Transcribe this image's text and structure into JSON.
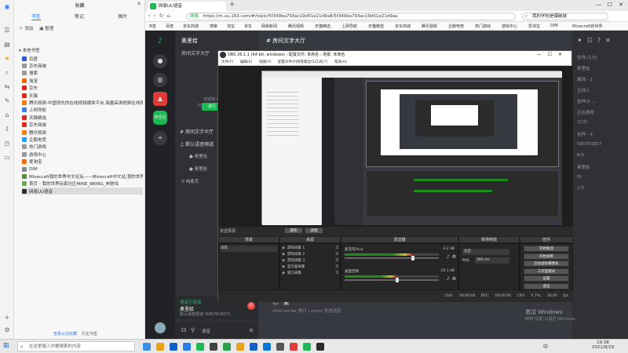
{
  "browser": {
    "tab_title": "网易UU语音",
    "tab_icon_text": "网易",
    "url": "https://m.uu.163.com/#/topic/5f349ba793ac19d51e21d9a8/5f349ba793ac19d51e21d9aa",
    "side_search": "我的学校是爆破城",
    "bookmarks": [
      "书签",
      "百度",
      "京东商城",
      "搜索",
      "淘宝",
      "京东",
      "网易新闻",
      "腾讯视频",
      "天猫精选",
      "上网导航",
      "天猫精选",
      "京东商城",
      "腾讯视频",
      "企鹅电竞",
      "热门游戏",
      "游戏中心",
      "爱淘宝",
      "DIM",
      "Minecraft的世界"
    ],
    "window_controls": [
      "—",
      "☐",
      "✕"
    ]
  },
  "favorites": {
    "header_title": "收藏",
    "tabs": [
      "书签",
      "笔记",
      "图片"
    ],
    "toolbar": [
      "添加",
      "整理"
    ],
    "root": "本地书签",
    "items": [
      {
        "label": "百度",
        "color": "#2b5bd7"
      },
      {
        "label": "京东商城",
        "color": "#999999"
      },
      {
        "label": "搜索",
        "color": "#999999"
      },
      {
        "label": "淘宝",
        "color": "#ff6a00"
      },
      {
        "label": "京东",
        "color": "#e1251b"
      },
      {
        "label": "天猫",
        "color": "#e1251b"
      },
      {
        "label": "腾讯视频-中国领先的在线视频媒体平台,海量高清视频在线观看",
        "color": "#ff7a00"
      },
      {
        "label": "上网导航",
        "color": "#3d7ae8"
      },
      {
        "label": "天猫精选",
        "color": "#e1251b"
      },
      {
        "label": "京东商城",
        "color": "#e1251b"
      },
      {
        "label": "腾讯视频",
        "color": "#ff7a00"
      },
      {
        "label": "企鹅电竞",
        "color": "#18a3ff"
      },
      {
        "label": "热门游戏",
        "color": "#999999"
      },
      {
        "label": "游戏中心",
        "color": "#999999"
      },
      {
        "label": "爱淘宝",
        "color": "#ff6a00"
      },
      {
        "label": "DIM",
        "color": "#888888"
      },
      {
        "label": "Minecraft我的世界中文论坛——Minecraft中文站,我的世界中文",
        "color": "#5a8d3a"
      },
      {
        "label": "首页 - 我的世界玩家社区MINE_BBING_奔驰咕",
        "color": "#6aa84f"
      },
      {
        "label": "网易UU语音",
        "color": "#2b2d31"
      }
    ],
    "footer": [
      "查看以往收藏",
      "历史书签"
    ]
  },
  "discord": {
    "server_label": "奥里给",
    "channel_header": "房间文字大厅",
    "channel_title": "# 房间文字大厅",
    "text_channel": "房间文字大厅",
    "voice_channel": "默认语音频道",
    "voice_users": [
      "奥里给",
      "奥里给"
    ],
    "mic_label": "纯麦克",
    "welcome_text": "欢迎加入服务器",
    "enter_channel_hint": "只需要聊一下 就可以进",
    "join_button": "进行",
    "user_name": "奥里给",
    "user_status": "默认语音频道 (585761827)",
    "status_sub": "语音已连接",
    "tab_label": "语音",
    "message_placeholder": "shift+enter 换行 / enter 发送消息",
    "members_header": "在线 - 1/3",
    "members": [
      "在线 (1/3)",
      "奥里给",
      "离线 - 2",
      "主持人",
      "吉祥(5 ...",
      "正在游戏",
      "(1/3)",
      "吉祥 - 4",
      "585761827",
      "6/3",
      "奥里给",
      "ID",
      "1/3"
    ],
    "top_icons": [
      "pin-icon",
      "members-icon",
      "help-icon",
      "close-icon"
    ]
  },
  "obs": {
    "title": "OBS 26.1.1 (64-bit, windows) - 配置文件: 未命名 - 场景: 未命名",
    "menu": [
      "文件(F)",
      "编辑(E)",
      "视图(V)",
      "配置文件(P)",
      "场景集合(S)",
      "工具(T)",
      "帮助(H)"
    ],
    "panels": {
      "scenes": "场景",
      "sources": "来源",
      "mixer": "混音器",
      "transitions": "转场特效",
      "controls": "控件"
    },
    "no_source_label": "未选择源",
    "properties_button": "属性",
    "filters_button": "滤镜",
    "scene_item": "场景",
    "sources": [
      "游戏采集 1",
      "游戏采集 2",
      "游戏采集 3",
      "显示器采集",
      "窗口采集"
    ],
    "mixer_tracks": [
      {
        "name": "麦克风/Aux",
        "db": "-3.2 dB",
        "level": 0.72
      },
      {
        "name": "桌面音频",
        "db": "-10.1 dB",
        "level": 0.55
      }
    ],
    "transition": {
      "type": "淡出",
      "duration_label": "时长",
      "duration": "300 ms"
    },
    "controls": [
      "开始推流",
      "开始录制",
      "启动虚拟摄像机",
      "工作室模式",
      "设置",
      "退出"
    ],
    "status": {
      "live": "LIVE: 00:00:00",
      "rec": "REC: 00:00:00",
      "cpu": "CPU: 0.7%, 30.00 fps"
    }
  },
  "taskbar": {
    "search_placeholder": "在这里输入你要搜索的内容",
    "time": "19:38",
    "date": "2021/8/29",
    "ime": "中",
    "activate_windows": "激活 Windows",
    "activate_hint": "转到\"设置\"以激活 Windows。"
  }
}
